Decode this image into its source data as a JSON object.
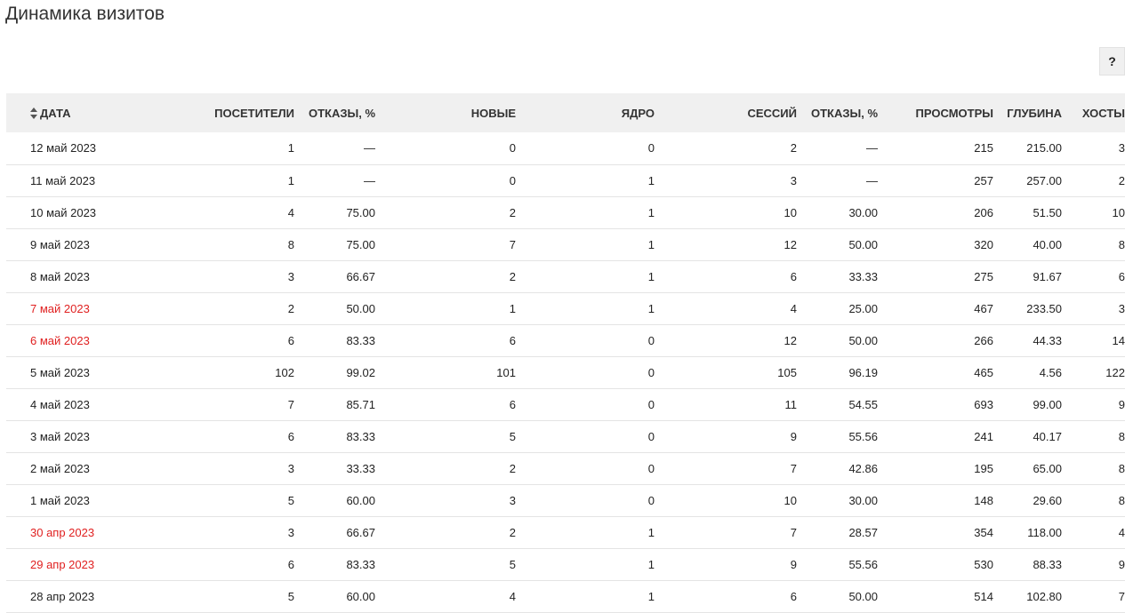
{
  "page": {
    "title": "Динамика визитов",
    "help_label": "?"
  },
  "table": {
    "headers": [
      "ДАТА",
      "ПОСЕТИТЕЛИ",
      "ОТКАЗЫ, %",
      "НОВЫЕ",
      "ЯДРО",
      "СЕССИЙ",
      "ОТКАЗЫ, %",
      "ПРОСМОТРЫ",
      "ГЛУБИНА",
      "ХОСТЫ"
    ],
    "sort_icon": "sort-icon",
    "weekend_color": "#e02020",
    "rows": [
      {
        "date": "12 май 2023",
        "weekend": false,
        "cells": [
          "1",
          "—",
          "0",
          "0",
          "2",
          "—",
          "215",
          "215.00",
          "3"
        ]
      },
      {
        "date": "11 май 2023",
        "weekend": false,
        "cells": [
          "1",
          "—",
          "0",
          "1",
          "3",
          "—",
          "257",
          "257.00",
          "2"
        ]
      },
      {
        "date": "10 май 2023",
        "weekend": false,
        "cells": [
          "4",
          "75.00",
          "2",
          "1",
          "10",
          "30.00",
          "206",
          "51.50",
          "10"
        ]
      },
      {
        "date": "9 май 2023",
        "weekend": false,
        "cells": [
          "8",
          "75.00",
          "7",
          "1",
          "12",
          "50.00",
          "320",
          "40.00",
          "8"
        ]
      },
      {
        "date": "8 май 2023",
        "weekend": false,
        "cells": [
          "3",
          "66.67",
          "2",
          "1",
          "6",
          "33.33",
          "275",
          "91.67",
          "6"
        ]
      },
      {
        "date": "7 май 2023",
        "weekend": true,
        "cells": [
          "2",
          "50.00",
          "1",
          "1",
          "4",
          "25.00",
          "467",
          "233.50",
          "3"
        ]
      },
      {
        "date": "6 май 2023",
        "weekend": true,
        "cells": [
          "6",
          "83.33",
          "6",
          "0",
          "12",
          "50.00",
          "266",
          "44.33",
          "14"
        ]
      },
      {
        "date": "5 май 2023",
        "weekend": false,
        "cells": [
          "102",
          "99.02",
          "101",
          "0",
          "105",
          "96.19",
          "465",
          "4.56",
          "122"
        ]
      },
      {
        "date": "4 май 2023",
        "weekend": false,
        "cells": [
          "7",
          "85.71",
          "6",
          "0",
          "11",
          "54.55",
          "693",
          "99.00",
          "9"
        ]
      },
      {
        "date": "3 май 2023",
        "weekend": false,
        "cells": [
          "6",
          "83.33",
          "5",
          "0",
          "9",
          "55.56",
          "241",
          "40.17",
          "8"
        ]
      },
      {
        "date": "2 май 2023",
        "weekend": false,
        "cells": [
          "3",
          "33.33",
          "2",
          "0",
          "7",
          "42.86",
          "195",
          "65.00",
          "8"
        ]
      },
      {
        "date": "1 май 2023",
        "weekend": false,
        "cells": [
          "5",
          "60.00",
          "3",
          "0",
          "10",
          "30.00",
          "148",
          "29.60",
          "8"
        ]
      },
      {
        "date": "30 апр 2023",
        "weekend": true,
        "cells": [
          "3",
          "66.67",
          "2",
          "1",
          "7",
          "28.57",
          "354",
          "118.00",
          "4"
        ]
      },
      {
        "date": "29 апр 2023",
        "weekend": true,
        "cells": [
          "6",
          "83.33",
          "5",
          "1",
          "9",
          "55.56",
          "530",
          "88.33",
          "9"
        ]
      },
      {
        "date": "28 апр 2023",
        "weekend": false,
        "cells": [
          "5",
          "60.00",
          "4",
          "1",
          "6",
          "50.00",
          "514",
          "102.80",
          "7"
        ]
      }
    ]
  }
}
